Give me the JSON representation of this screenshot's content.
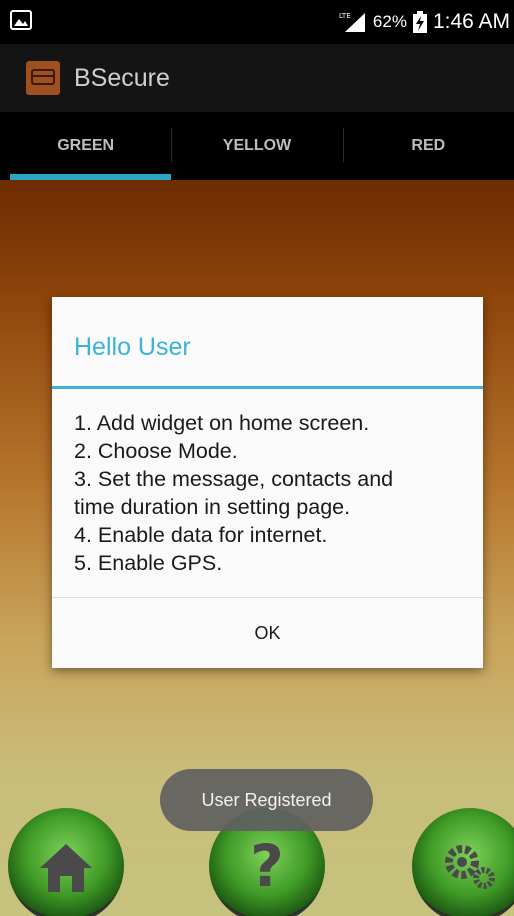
{
  "status_bar": {
    "network": "LTE",
    "battery": "62%",
    "time": "1:46 AM"
  },
  "app": {
    "title": "BSecure"
  },
  "tabs": [
    {
      "label": "GREEN",
      "selected": true
    },
    {
      "label": "YELLOW",
      "selected": false
    },
    {
      "label": "RED",
      "selected": false
    }
  ],
  "dialog": {
    "title": "Hello User",
    "lines": [
      "1. Add widget on home screen.",
      "2. Choose Mode.",
      "3. Set the message, contacts and",
      "time duration in setting page.",
      "4. Enable data for internet.",
      "5. Enable GPS."
    ],
    "ok_label": "OK"
  },
  "toast": {
    "text": "User Registered"
  },
  "bottom_buttons": [
    {
      "icon": "home-icon"
    },
    {
      "icon": "help-icon"
    },
    {
      "icon": "settings-icon"
    }
  ],
  "colors": {
    "accent": "#3bb3d8",
    "tab_indicator": "#2aa6c9"
  }
}
